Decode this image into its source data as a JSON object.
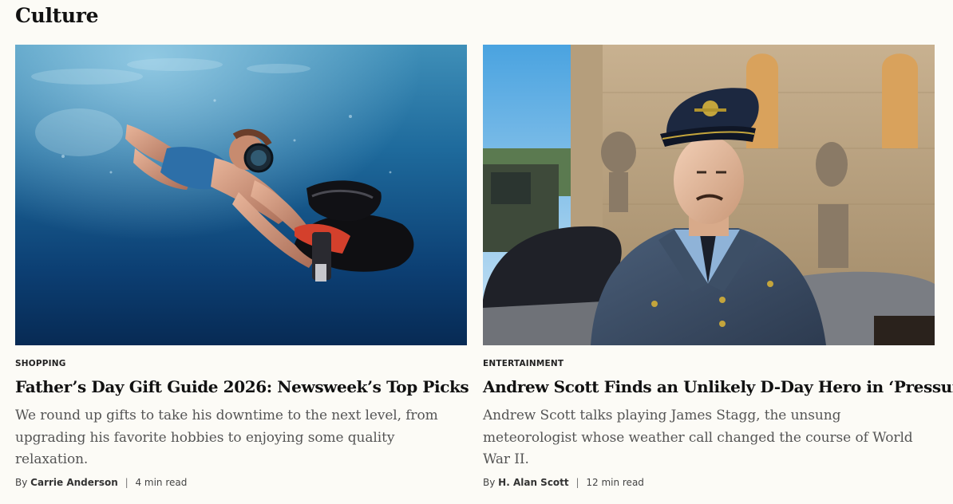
{
  "section": {
    "title": "Culture"
  },
  "articles": [
    {
      "category": "SHOPPING",
      "headline": "Father’s Day Gift Guide 2026: Newsweek’s Top Picks",
      "dek": "We round up gifts to take his downtime to the next level, from upgrading his favorite hobbies to enjoying some quality relaxation.",
      "by_prefix": "By",
      "author": "Carrie Anderson",
      "separator": "|",
      "read_time": "4 min read",
      "image_icon": "underwater-scooter-photo"
    },
    {
      "category": "ENTERTAINMENT",
      "headline": "Andrew Scott Finds an Unlikely D-Day Hero in ‘Pressure’",
      "dek": "Andrew Scott talks playing James Stagg, the unsung meteorologist whose weather call changed the course of World War II.",
      "by_prefix": "By",
      "author": "H. Alan Scott",
      "separator": "|",
      "read_time": "12 min read",
      "image_icon": "officer-portrait-photo"
    }
  ],
  "colors": {
    "background": "#fcfbf6",
    "headline": "#111111",
    "dek": "#555555",
    "byline": "#444444"
  }
}
